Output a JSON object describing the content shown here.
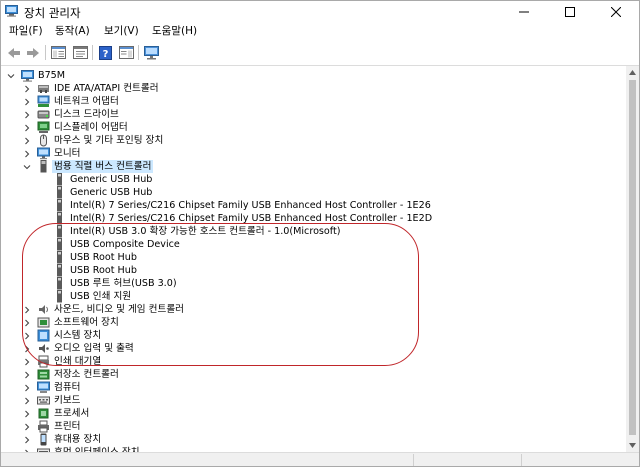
{
  "window": {
    "title": "장치 관리자",
    "icon": "device-manager-icon"
  },
  "menu": {
    "file": "파일(F)",
    "action": "동작(A)",
    "view": "보기(V)",
    "help": "도움말(H)"
  },
  "toolbar": {
    "buttons": [
      "back-arrow-icon",
      "forward-arrow-icon",
      "show-hide-console-tree-icon",
      "properties-icon",
      "help-icon",
      "action-pane-icon",
      "monitor-icon"
    ]
  },
  "tree": {
    "root": "B75M",
    "categories_top": [
      {
        "label": "IDE ATA/ATAPI 컨트롤러",
        "icon": "ide-controller-icon"
      },
      {
        "label": "네트워크 어댑터",
        "icon": "network-adapter-icon"
      },
      {
        "label": "디스크 드라이브",
        "icon": "disk-drive-icon"
      },
      {
        "label": "디스플레이 어댑터",
        "icon": "display-adapter-icon"
      },
      {
        "label": "마우스 및 기타 포인팅 장치",
        "icon": "mouse-icon"
      },
      {
        "label": "모니터",
        "icon": "monitor-icon"
      }
    ],
    "expanded_category": {
      "label": "범용 직렬 버스 컨트롤러",
      "icon": "usb-controller-icon"
    },
    "usb_devices": [
      "Generic USB Hub",
      "Generic USB Hub",
      "Intel(R) 7 Series/C216 Chipset Family USB Enhanced Host Controller - 1E26",
      "Intel(R) 7 Series/C216 Chipset Family USB Enhanced Host Controller - 1E2D",
      "Intel(R) USB 3.0 확장 가능한 호스트 컨트롤러 - 1.0(Microsoft)",
      "USB Composite Device",
      "USB Root Hub",
      "USB Root Hub",
      "USB 루트 허브(USB 3.0)",
      "USB 인쇄 지원"
    ],
    "categories_bottom": [
      {
        "label": "사운드, 비디오 및 게임 컨트롤러",
        "icon": "sound-icon"
      },
      {
        "label": "소프트웨어 장치",
        "icon": "software-device-icon"
      },
      {
        "label": "시스템 장치",
        "icon": "system-device-icon"
      },
      {
        "label": "오디오 입력 및 출력",
        "icon": "audio-io-icon"
      },
      {
        "label": "인쇄 대기열",
        "icon": "print-queue-icon"
      },
      {
        "label": "저장소 컨트롤러",
        "icon": "storage-controller-icon"
      },
      {
        "label": "컴퓨터",
        "icon": "computer-icon"
      },
      {
        "label": "키보드",
        "icon": "keyboard-icon"
      },
      {
        "label": "프로세서",
        "icon": "processor-icon"
      },
      {
        "label": "프린터",
        "icon": "printer-icon"
      },
      {
        "label": "휴대용 장치",
        "icon": "portable-device-icon"
      },
      {
        "label": "휴먼 인터페이스 장치",
        "icon": "hid-icon"
      }
    ]
  },
  "annotation": {
    "color": "#c0262a"
  },
  "colors": {
    "selection": "#cce8ff",
    "scroll_thumb": "#c1c1c1"
  }
}
